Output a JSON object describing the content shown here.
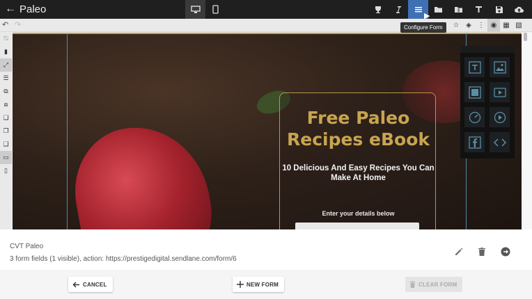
{
  "app": {
    "title": "Paleo"
  },
  "header": {
    "tooltip": "Configure Form",
    "tools": [
      "trophy-icon",
      "italic-icon",
      "form-list-icon",
      "folder-icon",
      "dollar-folder-icon",
      "text-icon",
      "save-icon",
      "cloud-upload-icon"
    ]
  },
  "canvas": {
    "form_title": "Free Paleo Recipes eBook",
    "form_subtitle": "10 Delicious And Easy Recipes You Can Make At Home",
    "form_prompt": "Enter your details below"
  },
  "form_info": {
    "name": "CVT Paleo",
    "description": "3 form fields (1 visible), action: https://prestigedigital.sendlane.com/form/6"
  },
  "buttons": {
    "cancel": "CANCEL",
    "new_form": "NEW FORM",
    "clear_form": "CLEAR FORM"
  },
  "colors": {
    "accent": "#3f6fb5",
    "title_gold": "#c7a550",
    "topbar": "#1f1f1f"
  }
}
